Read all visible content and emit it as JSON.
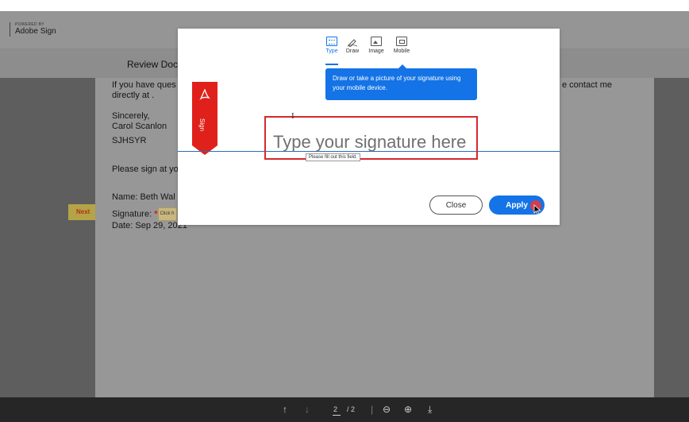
{
  "header": {
    "powered_by": "POWERED BY",
    "brand": "Adobe Sign"
  },
  "subheader": {
    "title": "Review Docu"
  },
  "document": {
    "line1": "If you have ques",
    "line2": "directly at .",
    "line1_right": "e contact me",
    "sincerely": "Sincerely,",
    "sender": "Carol Scanlon",
    "code": "SJHSYR",
    "please_sign": "Please sign at yo",
    "name_line": "Name: Beth Wal",
    "signature_label": "Signature:",
    "star": "*",
    "click_here": "Click h",
    "date_label": "Date:",
    "date_value": "Sep 29, 2021"
  },
  "next_flag": "Next",
  "modal": {
    "tabs": [
      {
        "label": "Type",
        "icon": "keyboard-icon",
        "active": true
      },
      {
        "label": "Draw",
        "icon": "pen-draw-icon",
        "active": false
      },
      {
        "label": "Image",
        "icon": "image-icon",
        "active": false
      },
      {
        "label": "Mobile",
        "icon": "mobile-icon",
        "active": false
      }
    ],
    "tooltip": "Draw or take a picture of your signature using your mobile device.",
    "ribbon_text": "Sign",
    "signature_placeholder": "Type your signature here",
    "validation_message": "Please fill out this field.",
    "close_label": "Close",
    "apply_label": "Apply"
  },
  "toolbar": {
    "page_current": "2",
    "page_total": "/ 2"
  },
  "colors": {
    "accent": "#1473e6",
    "highlight_red": "#d6282e",
    "ribbon_red": "#e0211b"
  }
}
